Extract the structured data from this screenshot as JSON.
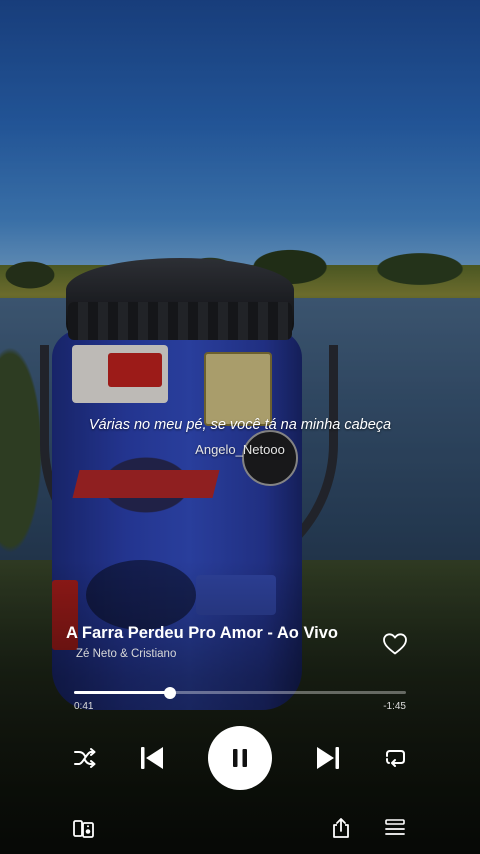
{
  "lyrics": {
    "line": "Várias no meu pé, se você tá na minha cabeça",
    "author": "Angelo_Netooo"
  },
  "track": {
    "title": "A Farra Perdeu Pro Amor - Ao Vivo",
    "artist": "Zé Neto & Cristiano",
    "liked": false
  },
  "progress": {
    "elapsed": "0:41",
    "remaining": "-1:45",
    "fraction": 0.29
  },
  "controls": {
    "shuffle_icon": "shuffle-icon",
    "previous_icon": "skip-previous-icon",
    "playpause_icon": "pause-icon",
    "next_icon": "skip-next-icon",
    "repeat_icon": "repeat-icon",
    "devices_icon": "connect-device-icon",
    "share_icon": "share-icon",
    "queue_icon": "queue-icon"
  },
  "colors": {
    "accent": "#ffffff",
    "progress_track": "rgba(255,255,255,0.35)"
  }
}
